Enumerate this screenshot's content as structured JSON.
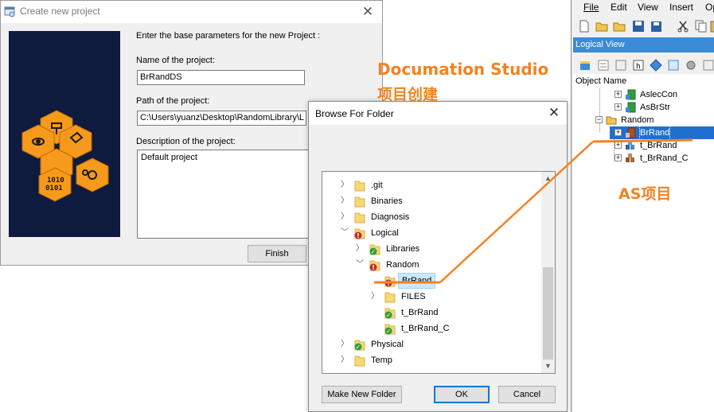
{
  "create_dialog": {
    "title": "Create new project",
    "intro": "Enter the base parameters for the new Project :",
    "name_label": "Name of the project:",
    "name_value": "BrRandDS",
    "path_label": "Path of the project:",
    "path_value": "C:\\Users\\yuanz\\Desktop\\RandomLibrary\\L",
    "desc_label": "Description of the project:",
    "desc_value": "Default project",
    "finish_label": "Finish",
    "banner_text": "1010 0101"
  },
  "browse_dialog": {
    "title": "Browse For Folder",
    "tree": [
      {
        "label": ".git",
        "chevron": "right",
        "badge": "none",
        "depth": 0
      },
      {
        "label": "Binaries",
        "chevron": "right",
        "badge": "none",
        "depth": 0
      },
      {
        "label": "Diagnosis",
        "chevron": "right",
        "badge": "none",
        "depth": 0
      },
      {
        "label": "Logical",
        "chevron": "down",
        "badge": "error",
        "depth": 0
      },
      {
        "label": "Libraries",
        "chevron": "right",
        "badge": "ok",
        "depth": 1
      },
      {
        "label": "Random",
        "chevron": "down",
        "badge": "error",
        "depth": 1
      },
      {
        "label": "BrRand",
        "chevron": "none",
        "badge": "error",
        "depth": 2,
        "selected": true
      },
      {
        "label": "FILES",
        "chevron": "right",
        "badge": "none",
        "depth": 2
      },
      {
        "label": "t_BrRand",
        "chevron": "none",
        "badge": "ok",
        "depth": 2
      },
      {
        "label": "t_BrRand_C",
        "chevron": "none",
        "badge": "ok",
        "depth": 2
      },
      {
        "label": "Physical",
        "chevron": "right",
        "badge": "ok",
        "depth": 0
      },
      {
        "label": "Temp",
        "chevron": "right",
        "badge": "none",
        "depth": 0
      }
    ],
    "make_folder_label": "Make New Folder",
    "ok_label": "OK",
    "cancel_label": "Cancel"
  },
  "as_window": {
    "menu": [
      "File",
      "Edit",
      "View",
      "Insert",
      "Op"
    ],
    "logical_view_title": "Logical View",
    "tree_header": "Object Name",
    "nodes": [
      {
        "label": "AslecCon",
        "icon": "green-library-icon",
        "level": 2
      },
      {
        "label": "AsBrStr",
        "icon": "green-library-icon",
        "level": 2
      },
      {
        "label": "Random",
        "icon": "folder-icon",
        "level": 1
      },
      {
        "label": "BrRand",
        "icon": "brown-library-icon",
        "level": 2,
        "selected": true
      },
      {
        "label": "t_BrRand",
        "icon": "program-icon",
        "level": 2
      },
      {
        "label": "t_BrRand_C",
        "icon": "program-c-icon",
        "level": 2
      }
    ]
  },
  "annotations": {
    "ds_line1": "Documation Studio",
    "ds_line2": "项目创建",
    "as_label": "AS项目",
    "color": "#f48220"
  }
}
